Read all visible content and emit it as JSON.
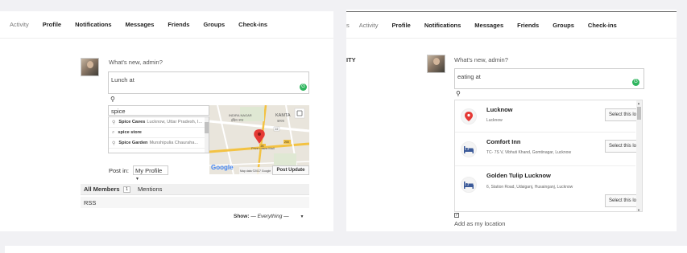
{
  "left": {
    "tabs": [
      "Activity",
      "Profile",
      "Notifications",
      "Messages",
      "Friends",
      "Groups",
      "Check-ins"
    ],
    "whats_new": "What's new, admin?",
    "textarea_value": "Lunch at",
    "search_value": "spice",
    "suggestions": [
      {
        "name": "Spice Caves",
        "sub": "Lucknow, Uttar Pradesh, I...",
        "icon": "pin-icon"
      },
      {
        "name": "spice store",
        "sub": "",
        "icon": "search-icon"
      },
      {
        "name": "Spice Garden",
        "sub": "Munshipulia Chauraha...",
        "icon": "pin-icon"
      }
    ],
    "map": {
      "labels": [
        "INDIRA NAGAR",
        "इंदिरा नगर",
        "KAMTA",
        "कमता",
        "Prize Plaza Mall",
        "Map data ©2017 Google",
        "Terms of Use"
      ],
      "road_numbers": [
        "26",
        "200",
        "22"
      ],
      "google": "Google"
    },
    "post_in_label": "Post in:",
    "post_in_value": "My Profile",
    "post_update": "Post Update",
    "filter_tabs": [
      "All Members",
      "Mentions"
    ],
    "members_count": "1",
    "rss": "RSS",
    "show_label": "Show:",
    "show_value": "— Everything —"
  },
  "right": {
    "tabs": [
      "s",
      "Activity",
      "Profile",
      "Notifications",
      "Messages",
      "Friends",
      "Groups",
      "Check-ins"
    ],
    "side_label": "ITY",
    "whats_new": "What's new, admin?",
    "textarea_value": "eating at",
    "locations": [
      {
        "name": "Lucknow",
        "addr": "Lucknow",
        "icon": "map-pin-icon",
        "button": "Select this location"
      },
      {
        "name": "Comfort Inn",
        "addr": "TC- 7S V, Vibhuti Khand, Gomtinagar, Lucknow",
        "icon": "bed-icon",
        "button": "Select this location"
      },
      {
        "name": "Golden Tulip Lucknow",
        "addr": "6, Station Road, Udaiganj, Husainganj, Lucknow",
        "icon": "bed-icon",
        "button": "Select this location"
      }
    ],
    "add_as_location": "Add as my location"
  },
  "colors": {
    "accent": "#2fb55e",
    "pin_red": "#e53935",
    "map_bg": "#e9e5dc",
    "road": "#f3c242"
  }
}
